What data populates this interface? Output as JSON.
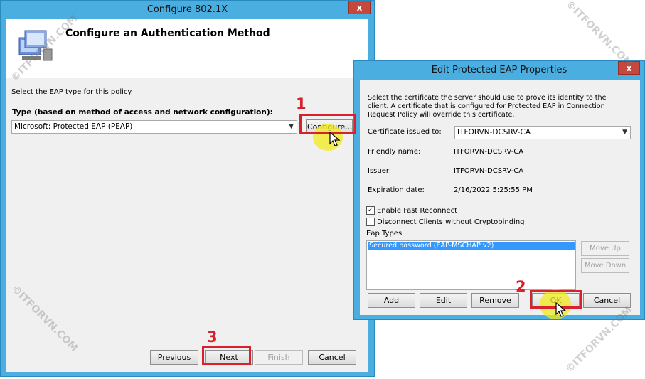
{
  "configure_dialog": {
    "title": "Configure 802.1X",
    "close_label": "x",
    "header_title": "Configure an Authentication Method",
    "instruction": "Select the EAP type for this policy.",
    "type_label": "Type (based on method of access and network configuration):",
    "type_value": "Microsoft: Protected EAP (PEAP)",
    "configure_button": "Configure...",
    "buttons": {
      "previous": "Previous",
      "next": "Next",
      "finish": "Finish",
      "cancel": "Cancel"
    }
  },
  "peap_dialog": {
    "title": "Edit Protected EAP Properties",
    "close_label": "x",
    "description": "Select the certificate the server should use to prove its identity to the client. A certificate that is configured for Protected EAP in Connection Request Policy will override this certificate.",
    "certificate_label": "Certificate issued to:",
    "certificate_value": "ITFORVN-DCSRV-CA",
    "friendly_name_label": "Friendly name:",
    "friendly_name_value": "ITFORVN-DCSRV-CA",
    "issuer_label": "Issuer:",
    "issuer_value": "ITFORVN-DCSRV-CA",
    "expiration_label": "Expiration date:",
    "expiration_value": "2/16/2022 5:25:55 PM",
    "fast_reconnect_label": "Enable Fast Reconnect",
    "fast_reconnect_checked": true,
    "disconnect_label": "Disconnect Clients without Cryptobinding",
    "disconnect_checked": false,
    "eap_types_label": "Eap Types",
    "eap_types": [
      "Secured password (EAP-MSCHAP v2)"
    ],
    "buttons": {
      "move_up": "Move Up",
      "move_down": "Move Down",
      "add": "Add",
      "edit": "Edit",
      "remove": "Remove",
      "ok": "OK",
      "cancel": "Cancel"
    }
  },
  "annotations": {
    "step1": "1",
    "step2": "2",
    "step3": "3"
  },
  "watermark": "©ITFORVN.COM",
  "colors": {
    "window_frame": "#4aaee0",
    "annotation_red": "#d6222c",
    "highlight_yellow": "#f0eb1e",
    "selection_blue": "#3399ff",
    "close_red": "#c6473b"
  }
}
